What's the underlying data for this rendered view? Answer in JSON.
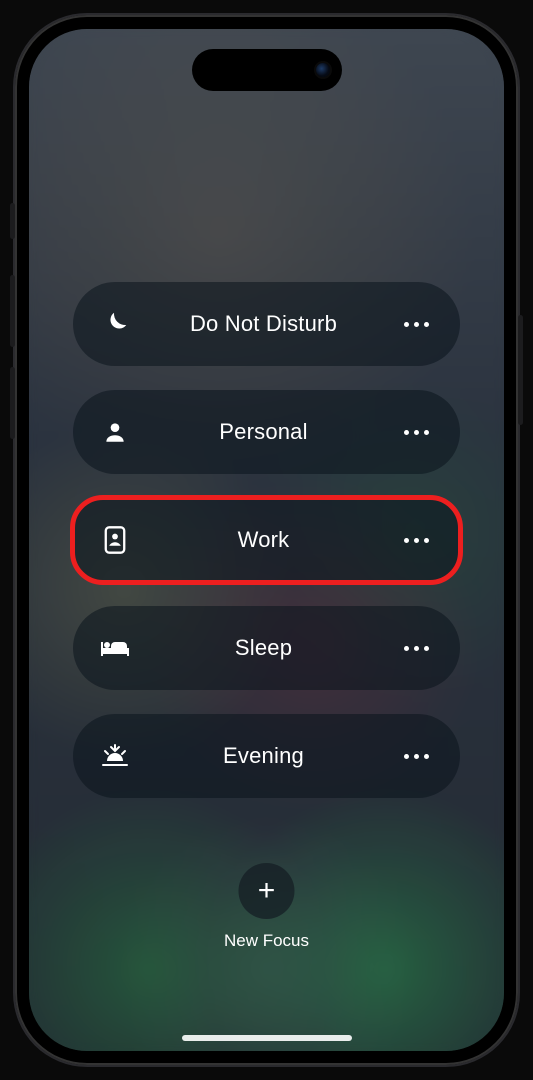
{
  "focus_modes": [
    {
      "id": "do-not-disturb",
      "icon": "moon",
      "label": "Do Not Disturb",
      "highlighted": false
    },
    {
      "id": "personal",
      "icon": "person",
      "label": "Personal",
      "highlighted": false
    },
    {
      "id": "work",
      "icon": "badge",
      "label": "Work",
      "highlighted": true
    },
    {
      "id": "sleep",
      "icon": "bed",
      "label": "Sleep",
      "highlighted": false
    },
    {
      "id": "evening",
      "icon": "sunset",
      "label": "Evening",
      "highlighted": false
    }
  ],
  "new_focus": {
    "label": "New Focus"
  }
}
